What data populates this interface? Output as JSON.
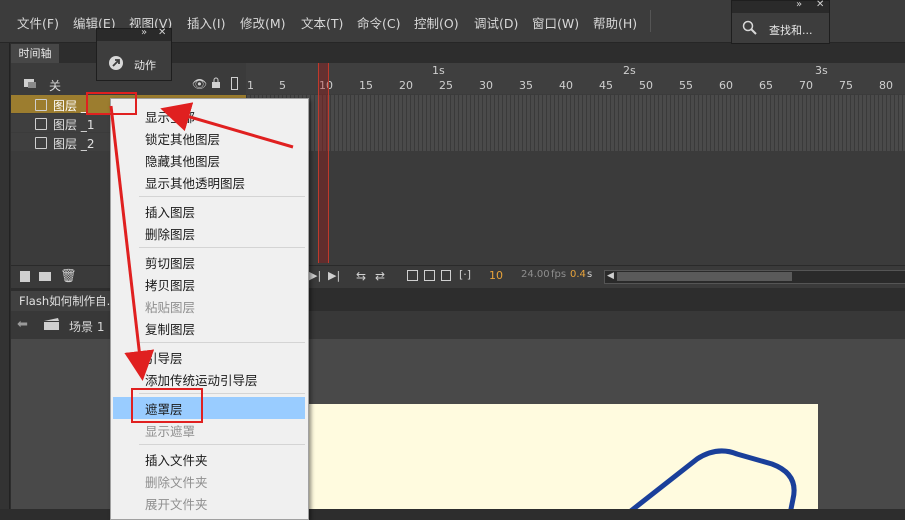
{
  "menubar": {
    "items": [
      "文件(F)",
      "编辑(E)",
      "视图(V)",
      "插入(I)",
      "修改(M)",
      "文本(T)",
      "命令(C)",
      "控制(O)",
      "调试(D)",
      "窗口(W)",
      "帮助(H)"
    ]
  },
  "actions_panel": {
    "label": "动作",
    "icon": "actions-icon"
  },
  "find_panel": {
    "label": "查找和...",
    "icon": "find-replace-icon"
  },
  "timeline": {
    "tab": "时间轴",
    "header_label": "关",
    "frame_numbers": [
      "1",
      "5",
      "10",
      "15",
      "20",
      "25",
      "30",
      "35",
      "40",
      "45",
      "50",
      "55",
      "60",
      "65",
      "70",
      "75",
      "80"
    ],
    "seconds": [
      "1s",
      "2s",
      "3s"
    ],
    "layers": [
      {
        "name": "图层 _",
        "selected": true
      },
      {
        "name": "图层 _1",
        "selected": false
      },
      {
        "name": "图层 _2",
        "selected": false
      }
    ],
    "current_frame": "10",
    "fps": "24.00",
    "fps_unit": "fps",
    "elapsed": "0.4",
    "elapsed_unit": "s"
  },
  "document": {
    "tab": "Flash如何制作自...",
    "scene": "场景 1"
  },
  "context_menu": {
    "items": [
      {
        "label": "显示全部",
        "disabled": false
      },
      {
        "label": "锁定其他图层",
        "disabled": false
      },
      {
        "label": "隐藏其他图层",
        "disabled": false
      },
      {
        "label": "显示其他透明图层",
        "disabled": false
      },
      {
        "label": "插入图层",
        "disabled": false
      },
      {
        "label": "删除图层",
        "disabled": false
      },
      {
        "label": "剪切图层",
        "disabled": false
      },
      {
        "label": "拷贝图层",
        "disabled": false
      },
      {
        "label": "粘贴图层",
        "disabled": true
      },
      {
        "label": "复制图层",
        "disabled": false
      },
      {
        "label": "引导层",
        "disabled": false
      },
      {
        "label": "添加传统运动引导层",
        "disabled": false
      },
      {
        "label": "遮罩层",
        "disabled": false,
        "highlighted": true
      },
      {
        "label": "显示遮罩",
        "disabled": true
      },
      {
        "label": "插入文件夹",
        "disabled": false
      },
      {
        "label": "删除文件夹",
        "disabled": true
      },
      {
        "label": "展开文件夹",
        "disabled": true
      }
    ]
  },
  "colors": {
    "highlight": "#99ccff",
    "annotation": "#e02020",
    "stage": "#fffbdf",
    "selected_layer": "#9c7d2f",
    "playhead": "#c0392b"
  }
}
